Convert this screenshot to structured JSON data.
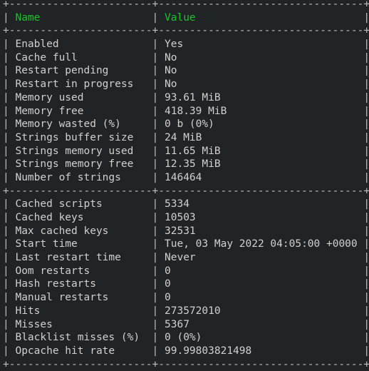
{
  "table": {
    "name_width": 21,
    "value_width": 31,
    "headers": {
      "name": "Name",
      "value": "Value"
    },
    "colors": {
      "header": "#1fbf2a",
      "text": "#d0d0d0",
      "border": "#bdbdbd",
      "background": "#212427"
    },
    "sections": [
      {
        "rows": [
          {
            "name": "Enabled",
            "value": "Yes"
          },
          {
            "name": "Cache full",
            "value": "No"
          },
          {
            "name": "Restart pending",
            "value": "No"
          },
          {
            "name": "Restart in progress",
            "value": "No"
          },
          {
            "name": "Memory used",
            "value": "93.61 MiB"
          },
          {
            "name": "Memory free",
            "value": "418.39 MiB"
          },
          {
            "name": "Memory wasted (%)",
            "value": "0 b (0%)"
          },
          {
            "name": "Strings buffer size",
            "value": "24 MiB"
          },
          {
            "name": "Strings memory used",
            "value": "11.65 MiB"
          },
          {
            "name": "Strings memory free",
            "value": "12.35 MiB"
          },
          {
            "name": "Number of strings",
            "value": "146464"
          }
        ]
      },
      {
        "rows": [
          {
            "name": "Cached scripts",
            "value": "5334"
          },
          {
            "name": "Cached keys",
            "value": "10503"
          },
          {
            "name": "Max cached keys",
            "value": "32531"
          },
          {
            "name": "Start time",
            "value": "Tue, 03 May 2022 04:05:00 +0000"
          },
          {
            "name": "Last restart time",
            "value": "Never"
          },
          {
            "name": "Oom restarts",
            "value": "0"
          },
          {
            "name": "Hash restarts",
            "value": "0"
          },
          {
            "name": "Manual restarts",
            "value": "0"
          },
          {
            "name": "Hits",
            "value": "273572010"
          },
          {
            "name": "Misses",
            "value": "5367"
          },
          {
            "name": "Blacklist misses (%)",
            "value": "0 (0%)"
          },
          {
            "name": "Opcache hit rate",
            "value": "99.99803821498"
          }
        ]
      }
    ]
  }
}
